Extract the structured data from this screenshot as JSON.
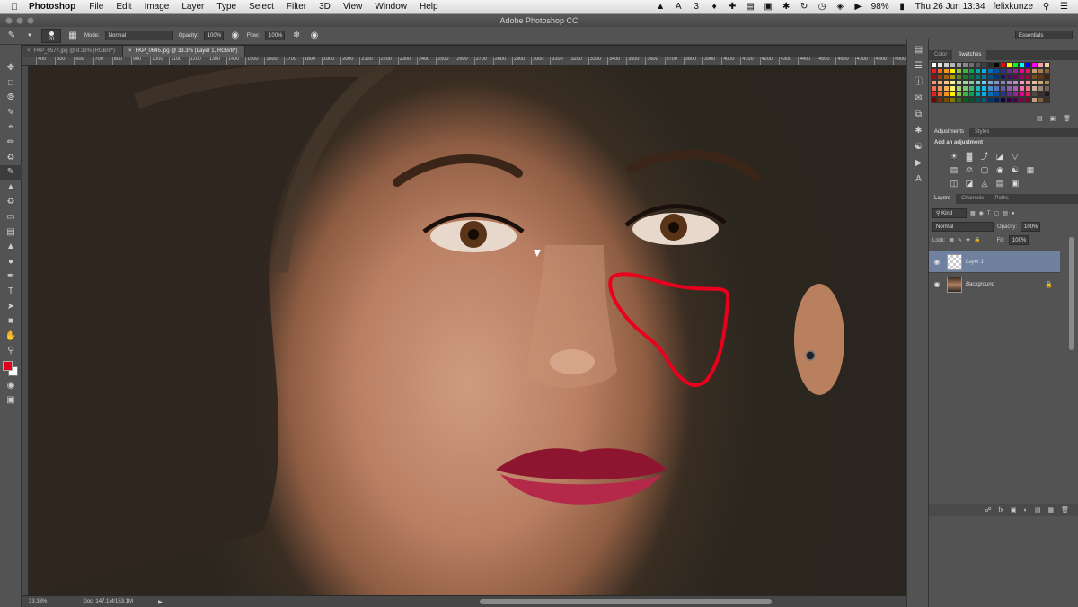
{
  "menubar": {
    "app_name": "Photoshop",
    "items": [
      "File",
      "Edit",
      "Image",
      "Layer",
      "Type",
      "Select",
      "Filter",
      "3D",
      "View",
      "Window",
      "Help"
    ],
    "battery": "98%",
    "datetime": "Thu 26 Jun  13:34",
    "user": "felixkunze"
  },
  "titlebar": {
    "title": "Adobe Photoshop CC"
  },
  "options": {
    "brush_size": "20",
    "mode_label": "Mode:",
    "mode_value": "Normal",
    "opacity_label": "Opacity:",
    "opacity_value": "100%",
    "flow_label": "Flow:",
    "flow_value": "100%",
    "workspace": "Essentials"
  },
  "tabs": [
    {
      "label": "FKP_0577.jpg @ 8.33% (RGB/8*)",
      "active": false
    },
    {
      "label": "FKP_0645.jpg @ 33.3% (Layer 1, RGB/8*)",
      "active": true
    }
  ],
  "ruler_ticks": [
    "400",
    "500",
    "600",
    "700",
    "800",
    "900",
    "1000",
    "1100",
    "1200",
    "1300",
    "1400",
    "1500",
    "1600",
    "1700",
    "1800",
    "1900",
    "2000",
    "2100",
    "2200",
    "2300",
    "2400",
    "2500",
    "2600",
    "2700",
    "2800",
    "2900",
    "3000",
    "3100",
    "3200",
    "3300",
    "3400",
    "3500",
    "3600",
    "3700",
    "3800",
    "3900",
    "4000",
    "4100",
    "4200",
    "4300",
    "4400",
    "4500",
    "4600",
    "4700",
    "4800",
    "4900"
  ],
  "status": {
    "zoom": "33.33%",
    "doc": "Doc: 147.1M/153.1M"
  },
  "panels": {
    "color_tab": "Color",
    "swatches_tab": "Swatches",
    "adjustments_tab": "Adjustments",
    "styles_tab": "Styles",
    "add_adjustment": "Add an adjustment",
    "layers_tab": "Layers",
    "channels_tab": "Channels",
    "paths_tab": "Paths",
    "filter_kind": "Kind",
    "blend_mode": "Normal",
    "opacity_label": "Opacity:",
    "opacity_value": "100%",
    "lock_label": "Lock:",
    "fill_label": "Fill:",
    "fill_value": "100%",
    "layers": [
      {
        "name": "Layer 1",
        "selected": true
      },
      {
        "name": "Background",
        "selected": false,
        "locked": true
      }
    ]
  },
  "colors": {
    "foreground": "#e0001b",
    "background": "#ffffff",
    "annotation": "#e8001c"
  },
  "swatch_colors": [
    "#ffffff",
    "#e8e8e8",
    "#d0d0d0",
    "#b8b8b8",
    "#a0a0a0",
    "#888888",
    "#707070",
    "#585858",
    "#404040",
    "#282828",
    "#000000",
    "#ff0000",
    "#ffff00",
    "#00ff00",
    "#00ffff",
    "#0000ff",
    "#ff00ff",
    "#f2a0a0",
    "#f8d0a0",
    "#ed1c24",
    "#f26522",
    "#f7941d",
    "#fff200",
    "#8dc63f",
    "#39b54a",
    "#00a651",
    "#00a99d",
    "#00aeef",
    "#0072bc",
    "#0054a6",
    "#2e3192",
    "#662d91",
    "#92278f",
    "#ec008c",
    "#ed145b",
    "#c69c6d",
    "#a67c52",
    "#8c6239",
    "#9e0b0f",
    "#a0410d",
    "#a36209",
    "#aba000",
    "#598527",
    "#1a7b30",
    "#007236",
    "#00746b",
    "#0076a3",
    "#004b80",
    "#003471",
    "#1b1464",
    "#440e62",
    "#630460",
    "#9e005d",
    "#9e0039",
    "#754c24",
    "#603913",
    "#42210b",
    "#f69679",
    "#f9ad81",
    "#fdc68a",
    "#fff799",
    "#c4df9b",
    "#a3d39c",
    "#82ca9d",
    "#7bcdc8",
    "#6dcff6",
    "#7da7d9",
    "#8393ca",
    "#8781bd",
    "#a186be",
    "#bd8cbf",
    "#f49ac1",
    "#f5989d",
    "#e6c19a",
    "#d2a97a",
    "#b08957",
    "#f26c4f",
    "#f68e56",
    "#fbaf5d",
    "#fff568",
    "#acd372",
    "#7cc576",
    "#3bb878",
    "#1abbb4",
    "#00bff3",
    "#438ccb",
    "#5574b9",
    "#605ca8",
    "#855fa8",
    "#a763a8",
    "#f06ea9",
    "#f26d7d",
    "#c7b299",
    "#998675",
    "#736357",
    "#ed1c24",
    "#f26522",
    "#f7941d",
    "#fff200",
    "#8dc63f",
    "#39b54a",
    "#00a651",
    "#00a99d",
    "#00aeef",
    "#0072bc",
    "#0054a6",
    "#2e3192",
    "#662d91",
    "#92278f",
    "#ec008c",
    "#ed145b",
    "#534741",
    "#362f2d",
    "#1e1b1a",
    "#790000",
    "#7b2e00",
    "#7d4900",
    "#827b00",
    "#406618",
    "#005e20",
    "#005826",
    "#005952",
    "#005b7f",
    "#003663",
    "#002157",
    "#0d004c",
    "#32004b",
    "#4b0049",
    "#7b0046",
    "#7a0026",
    "#c0a080",
    "#806040",
    "#403020"
  ]
}
